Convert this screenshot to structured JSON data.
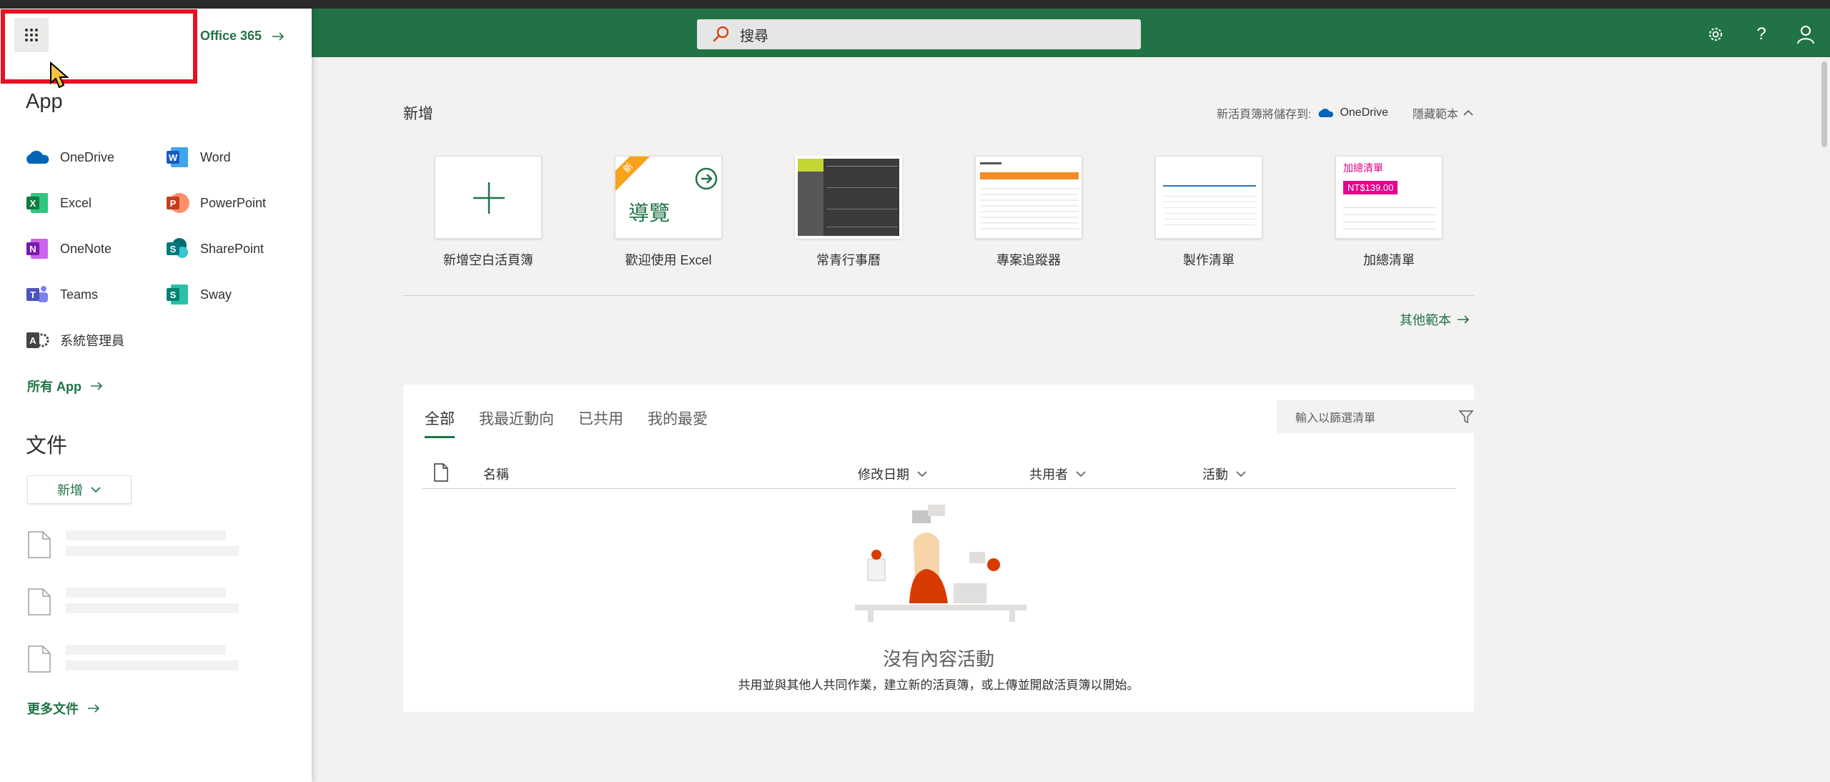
{
  "header": {
    "search_placeholder": "搜尋",
    "settings_icon": "gear-icon",
    "help_label": "?",
    "account_icon": "person-icon",
    "brand_color": "#217346"
  },
  "panel": {
    "office_link": "Office 365",
    "apps_heading": "App",
    "apps": [
      {
        "name": "OneDrive",
        "icon": "onedrive-icon"
      },
      {
        "name": "Word",
        "icon": "word-icon"
      },
      {
        "name": "Excel",
        "icon": "excel-icon"
      },
      {
        "name": "PowerPoint",
        "icon": "powerpoint-icon"
      },
      {
        "name": "OneNote",
        "icon": "onenote-icon"
      },
      {
        "name": "SharePoint",
        "icon": "sharepoint-icon"
      },
      {
        "name": "Teams",
        "icon": "teams-icon"
      },
      {
        "name": "Sway",
        "icon": "sway-icon"
      },
      {
        "name": "系統管理員",
        "icon": "admin-icon"
      }
    ],
    "all_apps": "所有 App",
    "docs_heading": "文件",
    "new_button": "新增",
    "more_files": "更多文件"
  },
  "main": {
    "new_heading": "新增",
    "save_to_label": "新活頁簿將儲存到:",
    "save_to_target": "OneDrive",
    "hide_templates": "隱藏範本",
    "templates": [
      {
        "label": "新增空白活頁簿"
      },
      {
        "label": "歡迎使用 Excel",
        "badge": "新",
        "thumb_text": "導覽"
      },
      {
        "label": "常青行事曆"
      },
      {
        "label": "專案追蹤器"
      },
      {
        "label": "製作清單"
      },
      {
        "label": "加總清單",
        "thumb_title": "加總清單",
        "thumb_price": "NT$139.00"
      }
    ],
    "more_templates": "其他範本",
    "tabs": [
      "全部",
      "我最近動向",
      "已共用",
      "我的最愛"
    ],
    "filter_placeholder": "輸入以篩選清單",
    "columns": {
      "name": "名稱",
      "modified": "修改日期",
      "shared_by": "共用者",
      "activity": "活動"
    },
    "empty_title": "沒有內容活動",
    "empty_desc": "共用並與其他人共同作業，建立新的活頁簿，或上傳並開啟活頁簿以開始。"
  }
}
